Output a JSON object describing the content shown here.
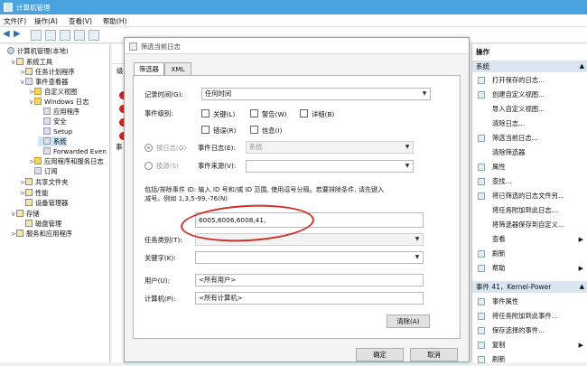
{
  "window": {
    "title": "计算机管理"
  },
  "menu": [
    "文件(F)",
    "操作(A)",
    "查看(V)",
    "帮助(H)"
  ],
  "tree": [
    {
      "label": "计算机管理(本地)",
      "indent": 0,
      "exp": "",
      "icon": "computer-icon"
    },
    {
      "label": "系统工具",
      "indent": 1,
      "exp": "∨",
      "icon": "tools-icon"
    },
    {
      "label": "任务计划程序",
      "indent": 2,
      "exp": ">",
      "icon": "clock-icon"
    },
    {
      "label": "事件查看器",
      "indent": 2,
      "exp": "∨",
      "icon": "event-viewer-icon"
    },
    {
      "label": "自定义视图",
      "indent": 3,
      "exp": ">",
      "icon": "folder-icon"
    },
    {
      "label": "Windows 日志",
      "indent": 3,
      "exp": "∨",
      "icon": "folder-icon"
    },
    {
      "label": "应用程序",
      "indent": 4,
      "exp": "",
      "icon": "log-icon"
    },
    {
      "label": "安全",
      "indent": 4,
      "exp": "",
      "icon": "log-icon"
    },
    {
      "label": "Setup",
      "indent": 4,
      "exp": "",
      "icon": "log-icon"
    },
    {
      "label": "系统",
      "indent": 4,
      "exp": "",
      "icon": "log-icon",
      "selected": true
    },
    {
      "label": "Forwarded Even",
      "indent": 4,
      "exp": "",
      "icon": "log-icon"
    },
    {
      "label": "应用程序和服务日志",
      "indent": 3,
      "exp": ">",
      "icon": "folder-icon"
    },
    {
      "label": "订阅",
      "indent": 3,
      "exp": "",
      "icon": "log-icon"
    },
    {
      "label": "共享文件夹",
      "indent": 2,
      "exp": ">",
      "icon": "shared-folder-icon"
    },
    {
      "label": "性能",
      "indent": 2,
      "exp": ">",
      "icon": "performance-icon"
    },
    {
      "label": "设备管理器",
      "indent": 2,
      "exp": "",
      "icon": "device-manager-icon"
    },
    {
      "label": "存储",
      "indent": 1,
      "exp": "∨",
      "icon": "storage-icon"
    },
    {
      "label": "磁盘管理",
      "indent": 2,
      "exp": "",
      "icon": "disk-icon"
    },
    {
      "label": "服务和应用程序",
      "indent": 1,
      "exp": ">",
      "icon": "services-icon"
    }
  ],
  "middle": {
    "col_header": "级",
    "tab_fragment": "事"
  },
  "actions": {
    "header": "操作",
    "section1": "系统",
    "section1_items": [
      {
        "label": "打开保存的日志...",
        "icon": "open-icon"
      },
      {
        "label": "创建自定义视图...",
        "icon": "filter-icon"
      },
      {
        "label": "导入自定义视图...",
        "icon": ""
      },
      {
        "label": "清除日志...",
        "icon": ""
      },
      {
        "label": "筛选当前日志...",
        "icon": "filter-icon"
      },
      {
        "label": "清除筛选器",
        "icon": ""
      },
      {
        "label": "属性",
        "icon": "properties-icon"
      },
      {
        "label": "查找...",
        "icon": "find-icon"
      },
      {
        "label": "将已筛选的日志文件另...",
        "icon": "save-icon"
      },
      {
        "label": "将任务附加到此日志...",
        "icon": ""
      },
      {
        "label": "将筛选器保存到自定义...",
        "icon": ""
      },
      {
        "label": "查看",
        "icon": "",
        "submenu": true
      },
      {
        "label": "刷新",
        "icon": "refresh-icon"
      },
      {
        "label": "帮助",
        "icon": "help-icon",
        "submenu": true
      }
    ],
    "section2": "事件 41，Kernel-Power",
    "section2_items": [
      {
        "label": "事件属性",
        "icon": "properties-icon"
      },
      {
        "label": "将任务附加到此事件...",
        "icon": "task-icon"
      },
      {
        "label": "保存选择的事件...",
        "icon": "save-icon"
      },
      {
        "label": "复制",
        "icon": "copy-icon",
        "submenu": true
      },
      {
        "label": "刷新",
        "icon": "refresh-icon"
      }
    ]
  },
  "dialog": {
    "title": "筛选当前日志",
    "tabs": [
      "筛选器",
      "XML"
    ],
    "logged_label": "记录时间(G):",
    "logged_value": "任何时间",
    "level_label": "事件级别:",
    "levels": [
      "关键(L)",
      "警告(W)",
      "详细(B)",
      "错误(R)",
      "信息(I)"
    ],
    "by_log_label": "按日志(O)",
    "event_logs_label": "事件日志(E):",
    "event_logs_value": "系统",
    "by_source_label": "按源(S)",
    "event_sources_label": "事件来源(V):",
    "event_sources_value": "",
    "desc_line1": "包括/排除事件 ID: 输入 ID 号和/或 ID 范围, 使用逗号分隔。若要排除条件, 请先键入",
    "desc_line2": "减号。例如 1,3,5-99,-76(N)",
    "event_ids_value": "6005,6006,6008,41,",
    "task_category_label": "任务类别(T):",
    "keywords_label": "关键字(K):",
    "user_label": "用户(U):",
    "user_value": "<所有用户>",
    "computer_label": "计算机(P):",
    "computer_value": "<所有计算机>",
    "clear_button": "清除(A)",
    "ok_button": "确定",
    "cancel_button": "取消"
  }
}
